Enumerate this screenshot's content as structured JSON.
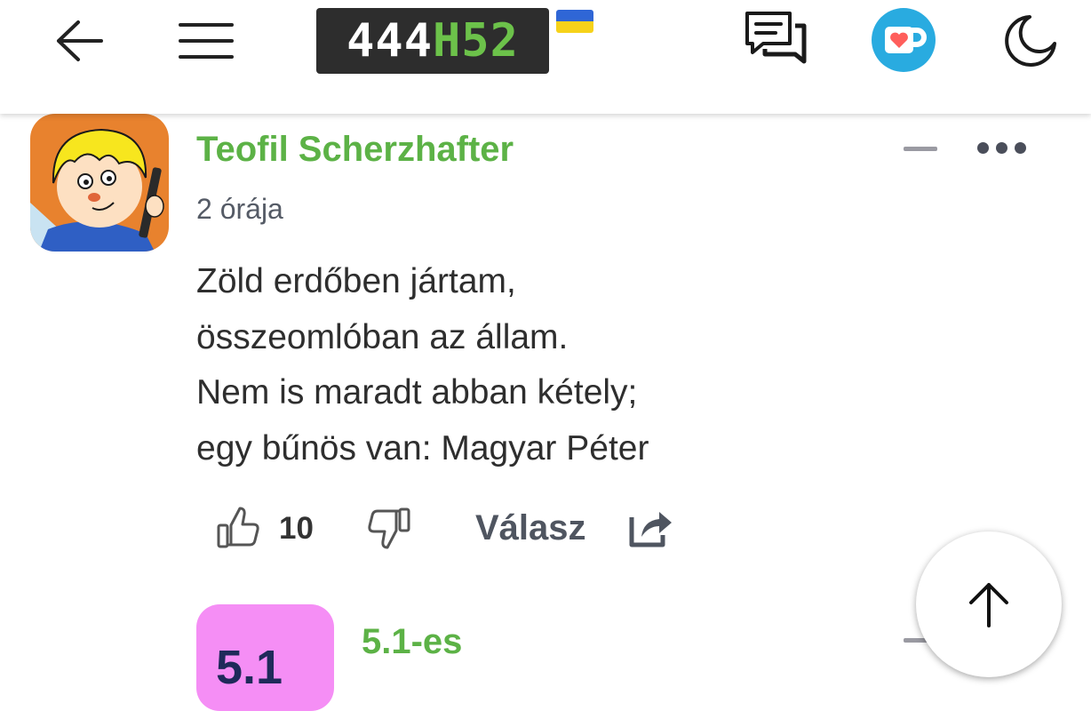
{
  "header": {
    "logo_white": "444",
    "logo_green": "H52",
    "icons": [
      "back-arrow-icon",
      "menu-icon",
      "logo",
      "ukraine-flag",
      "comments-icon",
      "ko-fi-icon",
      "moon-icon"
    ]
  },
  "comment": {
    "author": "Teofil Scherzhafter",
    "time": "2 órája",
    "lines": [
      "Zöld erdőben jártam,",
      "összeomlóban az állam.",
      "Nem is maradt abban kétely;",
      "egy bűnös van: Magyar Péter"
    ],
    "likes": "10",
    "reply_label": "Válasz"
  },
  "next_comment": {
    "avatar_text": "5.1",
    "author": "5.1-es"
  },
  "colors": {
    "accent_green": "#5cb246",
    "kofi_blue": "#29abe0",
    "avatar2_pink": "#f58ef5"
  }
}
